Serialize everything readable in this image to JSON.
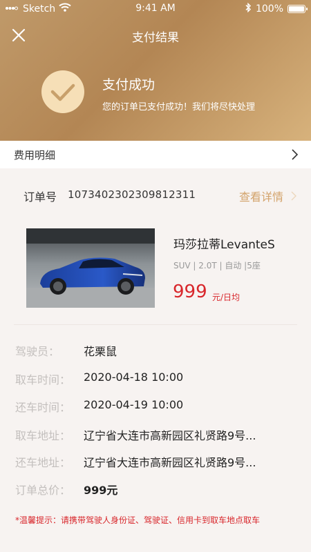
{
  "status_bar": {
    "carrier": "Sketch",
    "time": "9:41 AM",
    "battery": "100%"
  },
  "nav": {
    "title": "支付结果"
  },
  "result": {
    "title": "支付成功",
    "message": "您的订单已支付成功！我们将尽快处理"
  },
  "fee": {
    "label": "费用明细"
  },
  "order": {
    "number_label": "订单号",
    "number": "1073402302309812311",
    "view_detail": "查看详情"
  },
  "car": {
    "name": "玛莎拉蒂LevanteS",
    "spec": "SUV | 2.0T | 自动 |5座",
    "price": "999",
    "unit": "元/日均"
  },
  "details": [
    {
      "label": "驾驶员：",
      "value": "花栗鼠"
    },
    {
      "label": "取车时间：",
      "value": "2020-04-18 10:00"
    },
    {
      "label": "还车时间：",
      "value": "2020-04-19 10:00"
    },
    {
      "label": "取车地址：",
      "value": "辽宁省大连市高新园区礼贤路9号..."
    },
    {
      "label": "还车地址：",
      "value": "辽宁省大连市高新园区礼贤路9号..."
    },
    {
      "label": "订单总价：",
      "value": "999元"
    }
  ],
  "tip": "*温馨提示：请携带驾驶人身份证、驾驶证、信用卡到取车地点取车",
  "colors": {
    "header_gold": "#b38654",
    "accent_gold": "#d3a36b",
    "price_red": "#d8262b"
  }
}
